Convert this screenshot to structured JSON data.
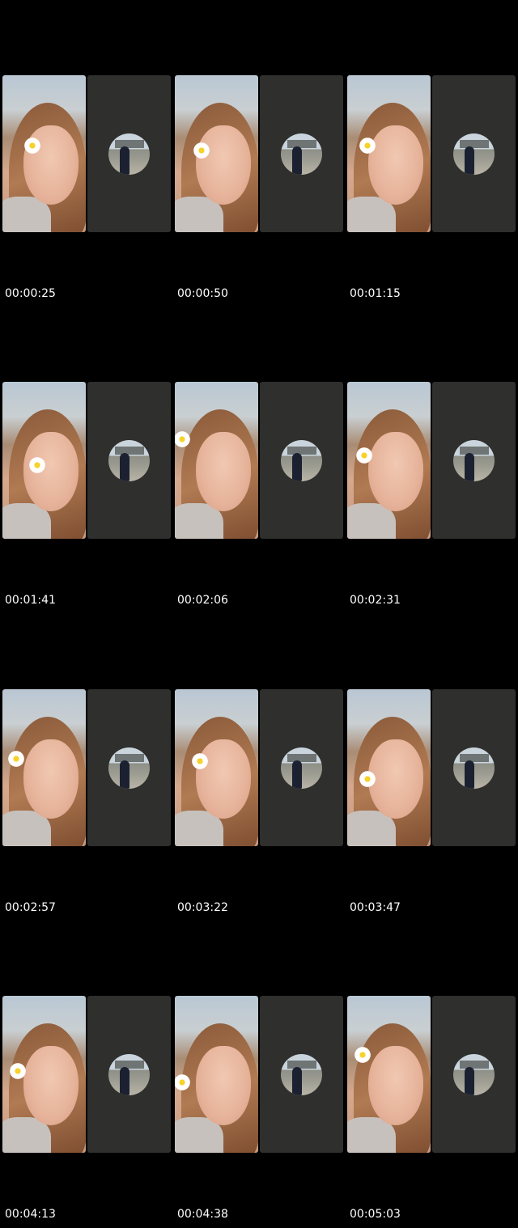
{
  "timestamps": [
    "00:00:25",
    "00:00:50",
    "00:01:15",
    "00:01:41",
    "00:02:06",
    "00:02:31",
    "00:02:57",
    "00:03:22",
    "00:03:47",
    "00:04:13",
    "00:04:38",
    "00:05:03"
  ],
  "colors": {
    "background": "#000000",
    "dark_pane": "#2f2f2d",
    "timestamp_text": "#ffffff"
  },
  "icons": {
    "hair_flower": "flower-icon"
  }
}
